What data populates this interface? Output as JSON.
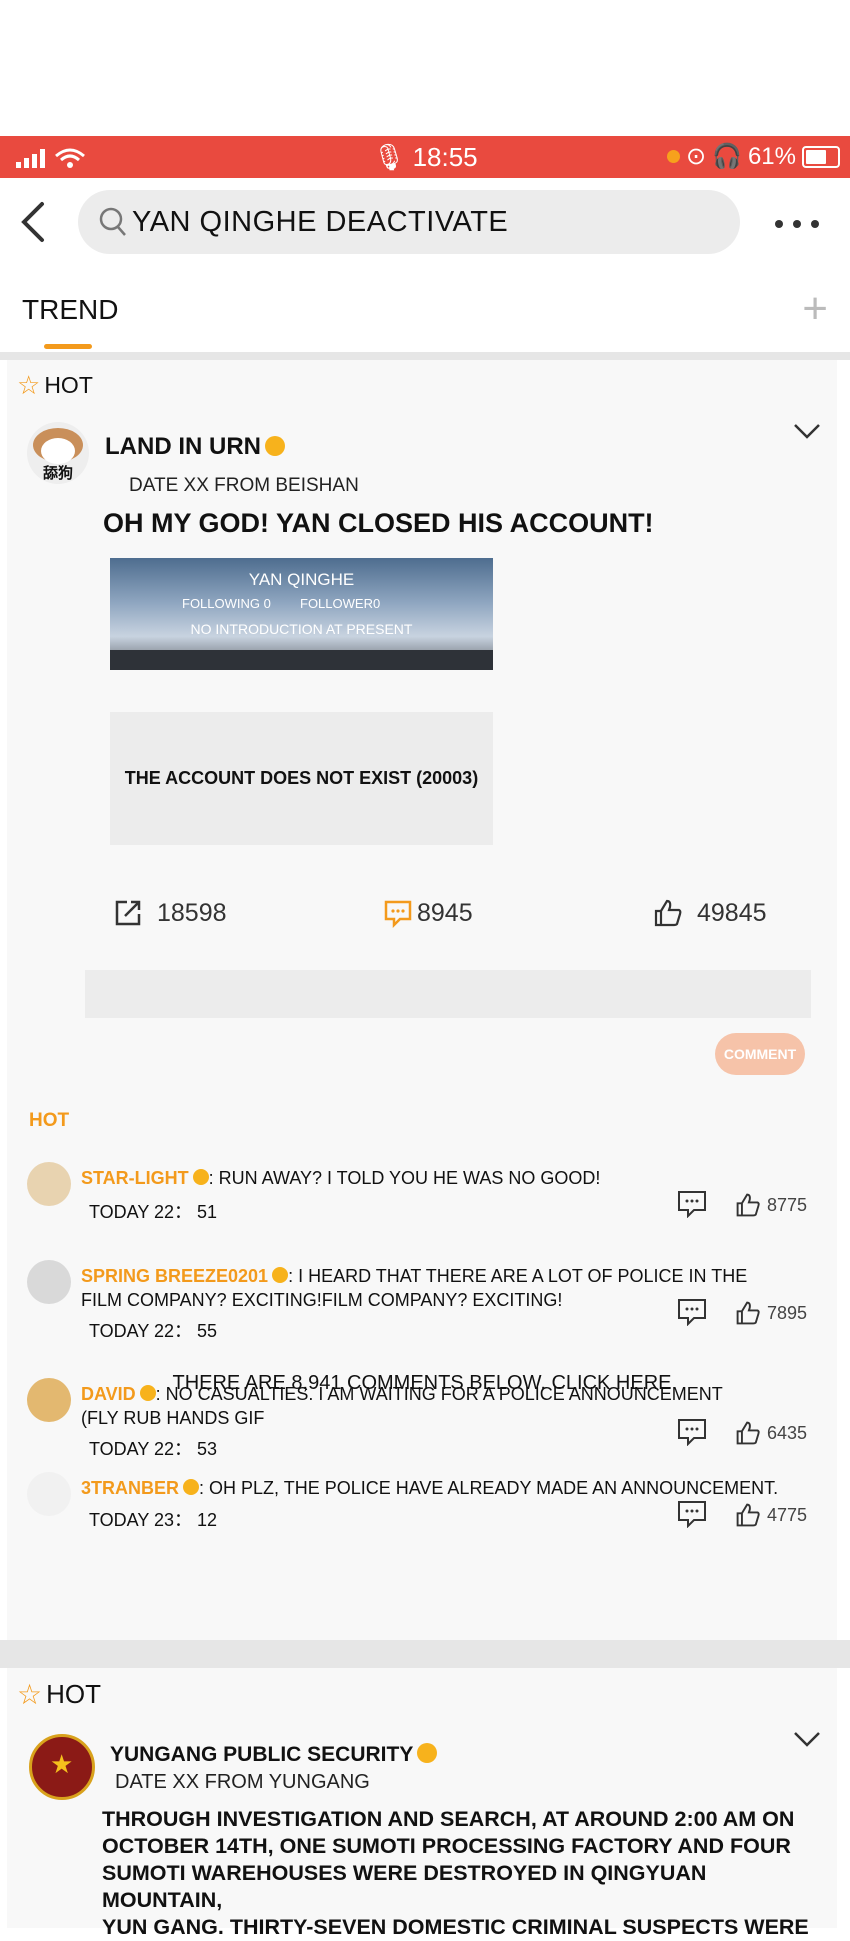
{
  "status_bar": {
    "time": "18:55",
    "battery": "61%"
  },
  "search": {
    "query": "YAN QINGHE DEACTIVATE"
  },
  "tabs": {
    "active": "TREND"
  },
  "post1": {
    "hot_label": "HOT",
    "author": "LAND IN URN",
    "avatar_text": "舔狗",
    "meta": "DATE XX  FROM BEISHAN",
    "title": "OH MY GOD! YAN CLOSED HIS ACCOUNT!",
    "profile": {
      "name": "YAN QINGHE",
      "following": "FOLLOWING 0",
      "followers": "FOLLOWER0",
      "intro": "NO INTRODUCTION AT PRESENT"
    },
    "not_exist": "THE ACCOUNT DOES NOT EXIST (20003)",
    "shares": "18598",
    "comments": "8945",
    "likes": "49845",
    "comment_button": "COMMENT",
    "hot_comments_label": "HOT",
    "hot_comments": [
      {
        "name": "STAR-LIGHT",
        "text": ": RUN AWAY? I TOLD YOU HE WAS NO GOOD!",
        "text2": "",
        "time": "TODAY 22： 51",
        "likes": "8775"
      },
      {
        "name": "SPRING BREEZE0201",
        "text": ": I HEARD THAT THERE ARE A LOT OF POLICE IN THE",
        "text2": "FILM COMPANY? EXCITING!FILM COMPANY? EXCITING!",
        "time": "TODAY 22： 55",
        "likes": "7895"
      },
      {
        "name": "DAVID",
        "text": ":  NO CASUALTIES. I AM WAITING FOR A POLICE ANNOUNCEMENT",
        "text2": "(FLY RUB HANDS GIF",
        "time": "TODAY 22： 53",
        "likes": "6435"
      },
      {
        "name": "3TRANBER",
        "text": ":  OH PLZ, THE POLICE HAVE ALREADY MADE AN ANNOUNCEMENT.",
        "text2": "",
        "time": "TODAY 23： 12",
        "likes": "4775"
      }
    ],
    "more_comments": "THERE ARE 8,941 COMMENTS BELOW. CLICK HERE"
  },
  "post2": {
    "hot_label": "HOT",
    "author": "YUNGANG PUBLIC SECURITY",
    "meta": "DATE XX FROM YUNGANG",
    "body_lines": [
      "THROUGH INVESTIGATION AND SEARCH, AT AROUND 2:00 AM ON",
      "OCTOBER 14TH, ONE SUMOTI PROCESSING FACTORY AND FOUR",
      "SUMOTI WAREHOUSES WERE DESTROYED IN QINGYUAN MOUNTAIN,",
      "YUN GANG. THIRTY-SEVEN DOMESTIC CRIMINAL SUSPECTS WERE"
    ]
  },
  "colors": {
    "accent": "#f39a1c",
    "status_bar": "#e94a3f"
  }
}
